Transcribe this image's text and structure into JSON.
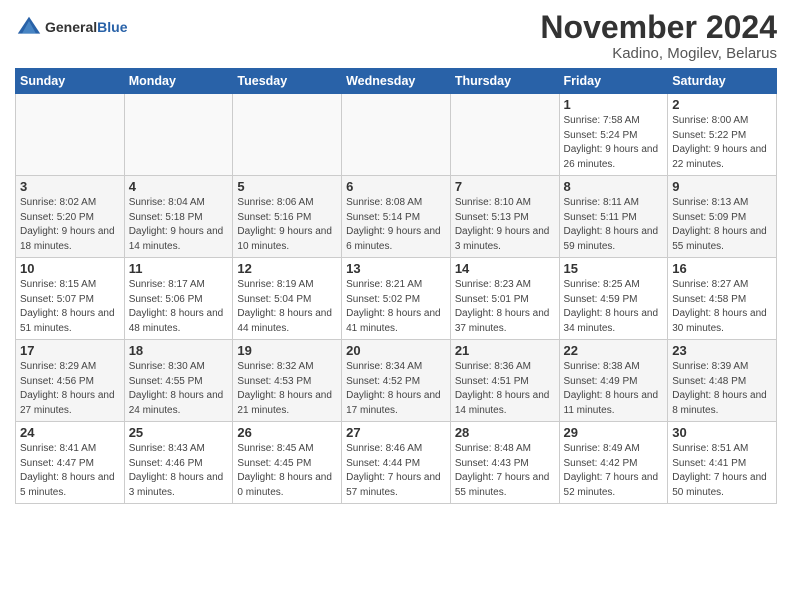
{
  "header": {
    "logo_general": "General",
    "logo_blue": "Blue",
    "month_title": "November 2024",
    "location": "Kadino, Mogilev, Belarus"
  },
  "weekdays": [
    "Sunday",
    "Monday",
    "Tuesday",
    "Wednesday",
    "Thursday",
    "Friday",
    "Saturday"
  ],
  "weeks": [
    [
      {
        "day": "",
        "info": ""
      },
      {
        "day": "",
        "info": ""
      },
      {
        "day": "",
        "info": ""
      },
      {
        "day": "",
        "info": ""
      },
      {
        "day": "",
        "info": ""
      },
      {
        "day": "1",
        "info": "Sunrise: 7:58 AM\nSunset: 5:24 PM\nDaylight: 9 hours\nand 26 minutes."
      },
      {
        "day": "2",
        "info": "Sunrise: 8:00 AM\nSunset: 5:22 PM\nDaylight: 9 hours\nand 22 minutes."
      }
    ],
    [
      {
        "day": "3",
        "info": "Sunrise: 8:02 AM\nSunset: 5:20 PM\nDaylight: 9 hours\nand 18 minutes."
      },
      {
        "day": "4",
        "info": "Sunrise: 8:04 AM\nSunset: 5:18 PM\nDaylight: 9 hours\nand 14 minutes."
      },
      {
        "day": "5",
        "info": "Sunrise: 8:06 AM\nSunset: 5:16 PM\nDaylight: 9 hours\nand 10 minutes."
      },
      {
        "day": "6",
        "info": "Sunrise: 8:08 AM\nSunset: 5:14 PM\nDaylight: 9 hours\nand 6 minutes."
      },
      {
        "day": "7",
        "info": "Sunrise: 8:10 AM\nSunset: 5:13 PM\nDaylight: 9 hours\nand 3 minutes."
      },
      {
        "day": "8",
        "info": "Sunrise: 8:11 AM\nSunset: 5:11 PM\nDaylight: 8 hours\nand 59 minutes."
      },
      {
        "day": "9",
        "info": "Sunrise: 8:13 AM\nSunset: 5:09 PM\nDaylight: 8 hours\nand 55 minutes."
      }
    ],
    [
      {
        "day": "10",
        "info": "Sunrise: 8:15 AM\nSunset: 5:07 PM\nDaylight: 8 hours\nand 51 minutes."
      },
      {
        "day": "11",
        "info": "Sunrise: 8:17 AM\nSunset: 5:06 PM\nDaylight: 8 hours\nand 48 minutes."
      },
      {
        "day": "12",
        "info": "Sunrise: 8:19 AM\nSunset: 5:04 PM\nDaylight: 8 hours\nand 44 minutes."
      },
      {
        "day": "13",
        "info": "Sunrise: 8:21 AM\nSunset: 5:02 PM\nDaylight: 8 hours\nand 41 minutes."
      },
      {
        "day": "14",
        "info": "Sunrise: 8:23 AM\nSunset: 5:01 PM\nDaylight: 8 hours\nand 37 minutes."
      },
      {
        "day": "15",
        "info": "Sunrise: 8:25 AM\nSunset: 4:59 PM\nDaylight: 8 hours\nand 34 minutes."
      },
      {
        "day": "16",
        "info": "Sunrise: 8:27 AM\nSunset: 4:58 PM\nDaylight: 8 hours\nand 30 minutes."
      }
    ],
    [
      {
        "day": "17",
        "info": "Sunrise: 8:29 AM\nSunset: 4:56 PM\nDaylight: 8 hours\nand 27 minutes."
      },
      {
        "day": "18",
        "info": "Sunrise: 8:30 AM\nSunset: 4:55 PM\nDaylight: 8 hours\nand 24 minutes."
      },
      {
        "day": "19",
        "info": "Sunrise: 8:32 AM\nSunset: 4:53 PM\nDaylight: 8 hours\nand 21 minutes."
      },
      {
        "day": "20",
        "info": "Sunrise: 8:34 AM\nSunset: 4:52 PM\nDaylight: 8 hours\nand 17 minutes."
      },
      {
        "day": "21",
        "info": "Sunrise: 8:36 AM\nSunset: 4:51 PM\nDaylight: 8 hours\nand 14 minutes."
      },
      {
        "day": "22",
        "info": "Sunrise: 8:38 AM\nSunset: 4:49 PM\nDaylight: 8 hours\nand 11 minutes."
      },
      {
        "day": "23",
        "info": "Sunrise: 8:39 AM\nSunset: 4:48 PM\nDaylight: 8 hours\nand 8 minutes."
      }
    ],
    [
      {
        "day": "24",
        "info": "Sunrise: 8:41 AM\nSunset: 4:47 PM\nDaylight: 8 hours\nand 5 minutes."
      },
      {
        "day": "25",
        "info": "Sunrise: 8:43 AM\nSunset: 4:46 PM\nDaylight: 8 hours\nand 3 minutes."
      },
      {
        "day": "26",
        "info": "Sunrise: 8:45 AM\nSunset: 4:45 PM\nDaylight: 8 hours\nand 0 minutes."
      },
      {
        "day": "27",
        "info": "Sunrise: 8:46 AM\nSunset: 4:44 PM\nDaylight: 7 hours\nand 57 minutes."
      },
      {
        "day": "28",
        "info": "Sunrise: 8:48 AM\nSunset: 4:43 PM\nDaylight: 7 hours\nand 55 minutes."
      },
      {
        "day": "29",
        "info": "Sunrise: 8:49 AM\nSunset: 4:42 PM\nDaylight: 7 hours\nand 52 minutes."
      },
      {
        "day": "30",
        "info": "Sunrise: 8:51 AM\nSunset: 4:41 PM\nDaylight: 7 hours\nand 50 minutes."
      }
    ]
  ]
}
